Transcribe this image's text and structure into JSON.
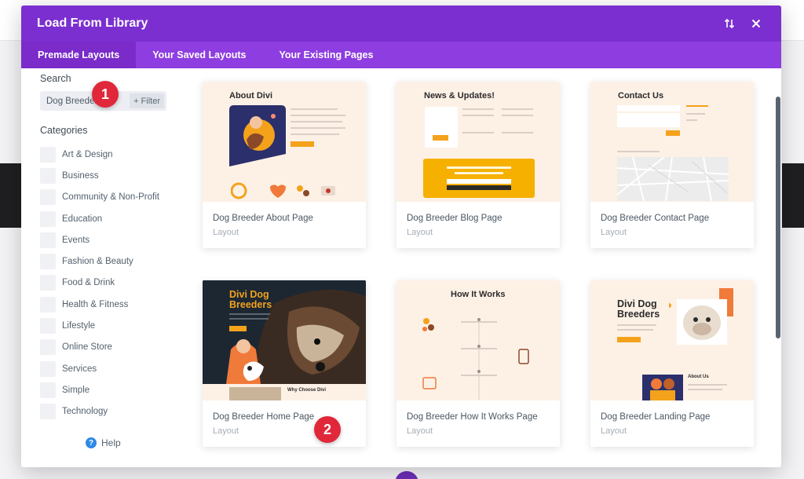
{
  "modal": {
    "title": "Load From Library",
    "tabs": [
      {
        "label": "Premade Layouts",
        "active": true
      },
      {
        "label": "Your Saved Layouts",
        "active": false
      },
      {
        "label": "Your Existing Pages",
        "active": false
      }
    ]
  },
  "sidebar": {
    "search_label": "Search",
    "search_value": "Dog Breeder",
    "filter_label": "+ Filter",
    "categories_label": "Categories",
    "categories": [
      "Art & Design",
      "Business",
      "Community & Non-Profit",
      "Education",
      "Events",
      "Fashion & Beauty",
      "Food & Drink",
      "Health & Fitness",
      "Lifestyle",
      "Online Store",
      "Services",
      "Simple",
      "Technology"
    ],
    "help_label": "Help"
  },
  "annotations": {
    "badge1": "1",
    "badge2": "2"
  },
  "layouts": [
    {
      "title": "Dog Breeder About Page",
      "type": "Layout",
      "thumb_heading": "About Divi"
    },
    {
      "title": "Dog Breeder Blog Page",
      "type": "Layout",
      "thumb_heading": "News & Updates!"
    },
    {
      "title": "Dog Breeder Contact Page",
      "type": "Layout",
      "thumb_heading": "Contact Us"
    },
    {
      "title": "Dog Breeder Home Page",
      "type": "Layout",
      "thumb_heading": "Divi Dog Breeders",
      "thumb_subheading": "Why Choose Divi"
    },
    {
      "title": "Dog Breeder How It Works Page",
      "type": "Layout",
      "thumb_heading": "How It Works"
    },
    {
      "title": "Dog Breeder Landing Page",
      "type": "Layout",
      "thumb_heading": "Divi Dog Breeders",
      "thumb_subheading": "About Us"
    }
  ],
  "colors": {
    "header": "#7b2fd0",
    "tabs": "#8e3ee0",
    "accent_orange": "#f4a21c",
    "badge": "#e0283a",
    "help": "#2e88e6"
  }
}
